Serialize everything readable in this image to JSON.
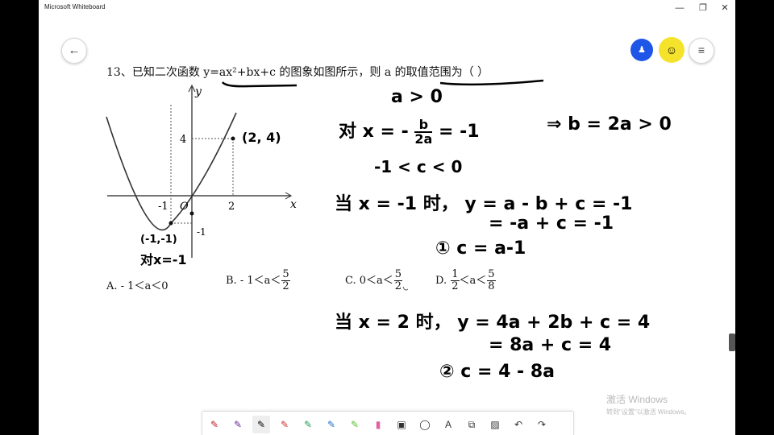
{
  "window": {
    "title": "Microsoft Whiteboard",
    "minimize": "—",
    "restore": "❐",
    "close": "✕"
  },
  "nav": {
    "back_icon": "←",
    "avatar_icon": "person-icon",
    "avatar_glyph": "♟",
    "collab_glyph": "☺",
    "menu_glyph": "≡"
  },
  "problem": {
    "number": "13、",
    "text_before": "已知二次函数 ",
    "formula": "y=ax²+bx+c",
    "text_after": " 的图象如图所示，则 a 的取值范围为（      ）"
  },
  "graph": {
    "y_axis": "y",
    "x_axis": "x",
    "origin": "O",
    "tick_x_neg1": "-1",
    "tick_x_2": "2",
    "tick_y_4": "4",
    "tick_y_neg1": "-1",
    "point_label": "(2, 4)",
    "vertex_label": "(-1,-1)",
    "axis_note": "对x=-1"
  },
  "options": {
    "a": "A.  - 1＜a＜0",
    "b_prefix": "B.  - 1＜a＜",
    "b_num": "5",
    "b_den": "2",
    "c_prefix": "C.  0＜a＜",
    "c_num": "5",
    "c_den": "2",
    "d_prefix": "D.",
    "d_num1": "1",
    "d_den1": "2",
    "d_mid": "＜a＜",
    "d_num2": "5",
    "d_den2": "8"
  },
  "handwriting": {
    "l1": "a > 0",
    "l2a": "对 x = -",
    "l2num": "b",
    "l2den": "2a",
    "l2b": "= -1",
    "l2c": "⇒  b = 2a > 0",
    "l3": "-1 < c < 0",
    "l4": "当 x = -1 时，  y =  a - b + c = -1",
    "l5": "= -a + c = -1",
    "l6": "①  c = a-1",
    "l7": "当 x = 2 时，  y = 4a + 2b + c = 4",
    "l8": "= 8a + c = 4",
    "l9": "②  c = 4 - 8a"
  },
  "watermark": {
    "line1": "激活 Windows",
    "line2": "转到\"设置\"以激活 Windows。"
  },
  "toolbar": {
    "tools": [
      "✎",
      "✎",
      "✎",
      "✎",
      "✎",
      "✎",
      "✎",
      "▮",
      "▣",
      "◯",
      "A",
      "⧉",
      "▨",
      "↶",
      "↷"
    ]
  }
}
